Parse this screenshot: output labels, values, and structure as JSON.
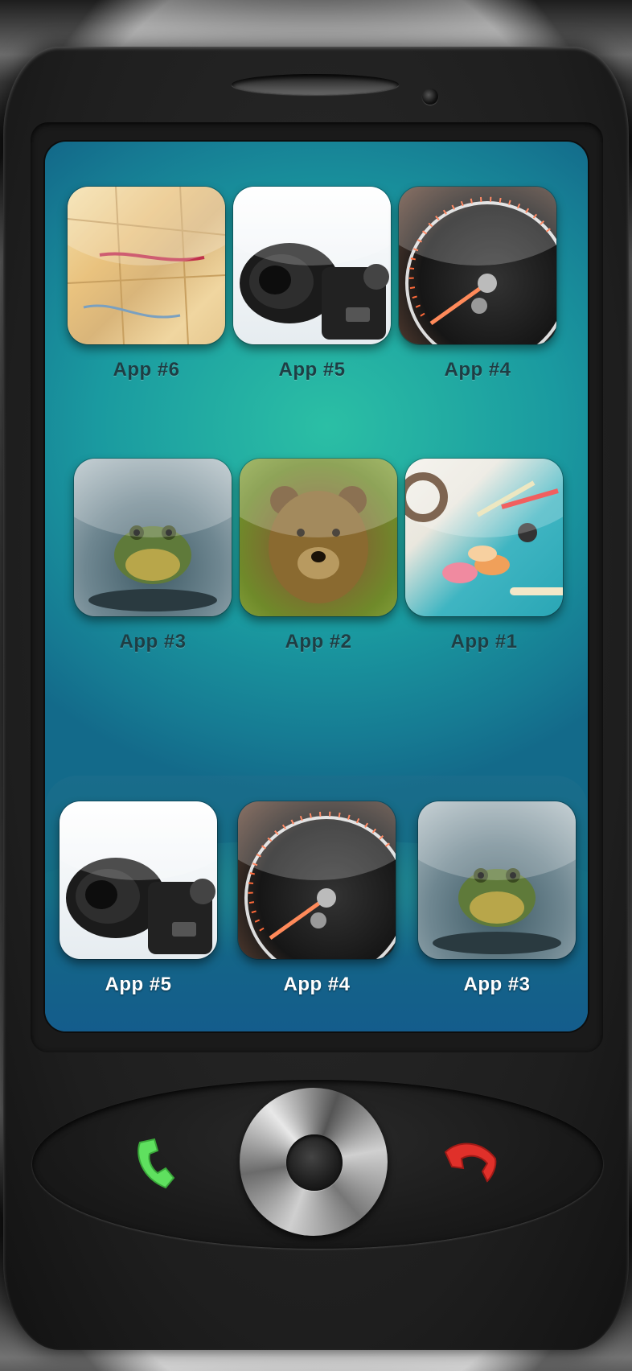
{
  "colors": {
    "screen_top": "#2bbfa5",
    "screen_bottom": "#136a8a",
    "call_green": "#5fe05f",
    "end_red": "#e0302a"
  },
  "grid_apps": [
    {
      "label": "App #6",
      "image": "map"
    },
    {
      "label": "App #5",
      "image": "camera"
    },
    {
      "label": "App #4",
      "image": "speedometer"
    },
    {
      "label": "App #3",
      "image": "frog"
    },
    {
      "label": "App #2",
      "image": "bear"
    },
    {
      "label": "App #1",
      "image": "craft-tools"
    }
  ],
  "dock_apps": [
    {
      "label": "App #5",
      "image": "camera"
    },
    {
      "label": "App #4",
      "image": "speedometer"
    },
    {
      "label": "App #3",
      "image": "frog"
    }
  ],
  "hardware": {
    "call_icon": "call-icon",
    "end_call_icon": "end-call-icon",
    "nav_pad": "nav-pad"
  }
}
